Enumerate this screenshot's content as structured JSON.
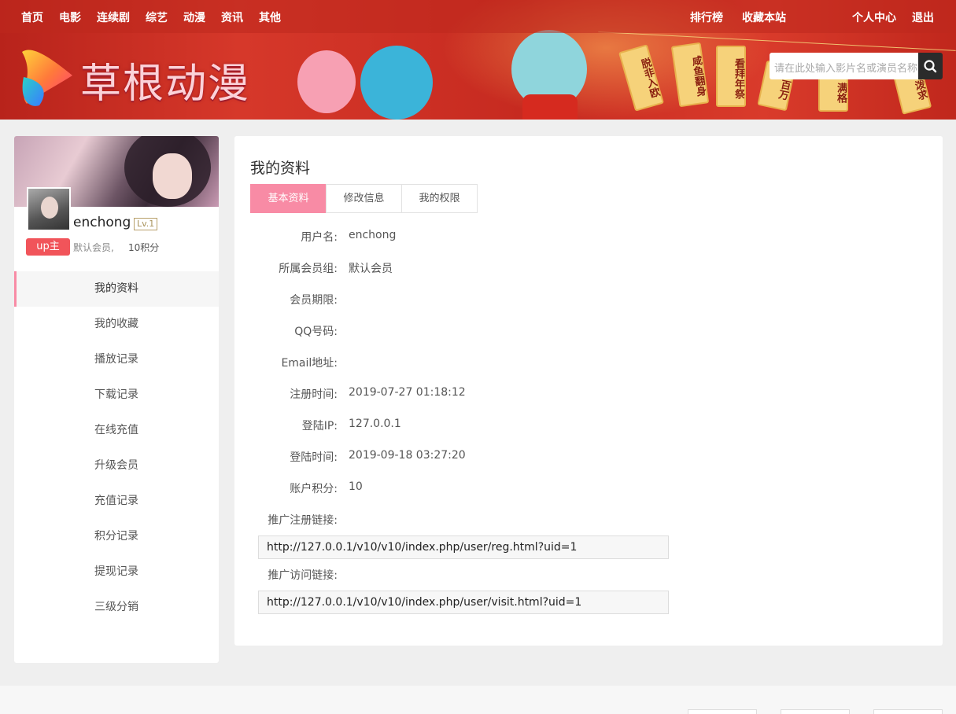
{
  "nav": {
    "items": [
      "首页",
      "电影",
      "连续剧",
      "综艺",
      "动漫",
      "资讯",
      "其他"
    ],
    "right": [
      "排行榜",
      "收藏本站"
    ],
    "user": [
      "个人中心",
      "退出"
    ]
  },
  "brand": {
    "name": "草根动漫"
  },
  "banner_tags": [
    "脱非入欧",
    "咸鱼翻身",
    "看拜年祭",
    "百万",
    "满格",
    "泼求"
  ],
  "search": {
    "placeholder": "请在此处输入影片名或演员名称",
    "icon": "search-icon"
  },
  "profile": {
    "username": "enchong",
    "level": "Lv.1",
    "badge": "up主",
    "group": "默认会员,",
    "points": "10积分"
  },
  "menu": {
    "items": [
      "我的资料",
      "我的收藏",
      "播放记录",
      "下载记录",
      "在线充值",
      "升级会员",
      "充值记录",
      "积分记录",
      "提现记录",
      "三级分销"
    ],
    "active_index": 0
  },
  "main": {
    "title": "我的资料",
    "tabs": [
      "基本资料",
      "修改信息",
      "我的权限"
    ],
    "fields": [
      {
        "label": "用户名:",
        "value": "enchong"
      },
      {
        "label": "所属会员组:",
        "value": "默认会员"
      },
      {
        "label": "会员期限:",
        "value": ""
      },
      {
        "label": "QQ号码:",
        "value": ""
      },
      {
        "label": "Email地址:",
        "value": ""
      },
      {
        "label": "注册时间:",
        "value": "2019-07-27 01:18:12"
      },
      {
        "label": "登陆IP:",
        "value": "127.0.0.1"
      },
      {
        "label": "登陆时间:",
        "value": "2019-09-18 03:27:20"
      },
      {
        "label": "账户积分:",
        "value": "10"
      }
    ],
    "reg_link_label": "推广注册链接:",
    "reg_link": "http://127.0.0.1/v10/v10/index.php/user/reg.html?uid=1",
    "visit_link_label": "推广访问链接:",
    "visit_link": "http://127.0.0.1/v10/v10/index.php/user/visit.html?uid=1"
  },
  "colors": {
    "accent": "#f88ba5",
    "badge": "#f1545a",
    "banner": "#c62a20"
  }
}
